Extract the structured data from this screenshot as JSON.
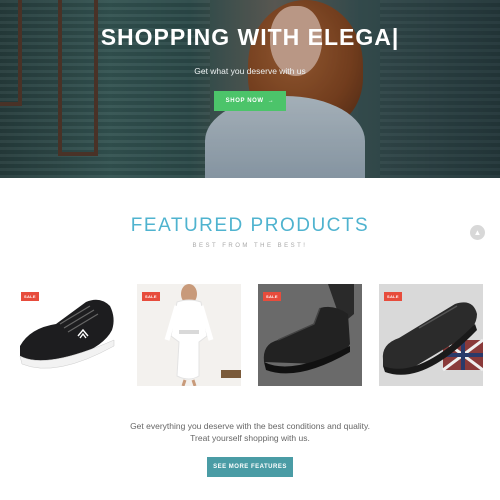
{
  "hero": {
    "title": "SHOPPING WITH ELEGA|",
    "subtitle": "Get what you deserve with us",
    "button_label": "SHOP NOW",
    "button_arrow": "→"
  },
  "featured": {
    "title": "FEATURED PRODUCTS",
    "subtitle": "BEST FROM THE BEST!"
  },
  "scroll_top_icon": "▲",
  "products": [
    {
      "badge": "SALE",
      "image": "black sneaker"
    },
    {
      "badge": "SALE",
      "image": "white lace dress"
    },
    {
      "badge": "SALE",
      "image": "black leather boot"
    },
    {
      "badge": "SALE",
      "image": "black leather loafer"
    }
  ],
  "description": "Get everything you deserve with the best conditions and quality. Treat yourself shopping with us.",
  "more_button_label": "SEE MORE FEATURES",
  "colors": {
    "accent_green": "#4cc46a",
    "heading_blue": "#4fb3cf",
    "sale_red": "#e74c3c",
    "teal_button": "#4a9ca5"
  }
}
